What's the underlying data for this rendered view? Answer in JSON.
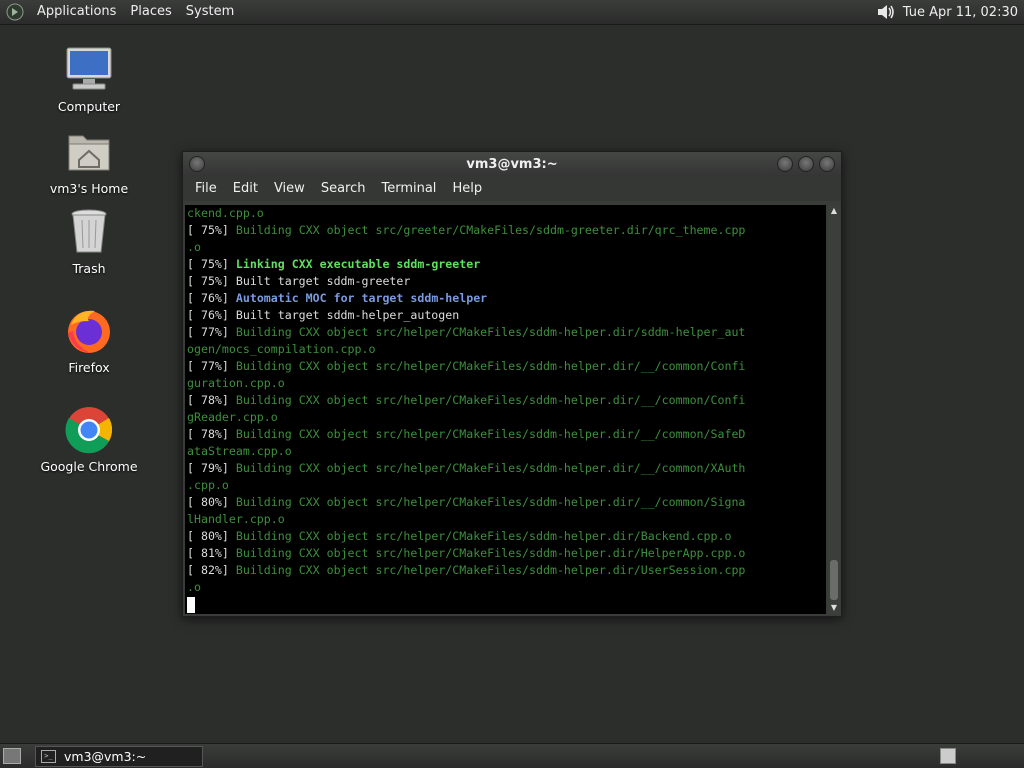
{
  "top_panel": {
    "menus": [
      "Applications",
      "Places",
      "System"
    ],
    "clock": "Tue Apr 11, 02:30",
    "logo_icon": "gnome-foot-icon",
    "volume_icon": "speaker-icon"
  },
  "desktop": {
    "icons": [
      {
        "label": "Computer",
        "icon": "computer-icon"
      },
      {
        "label": "vm3's Home",
        "icon": "home-folder-icon"
      },
      {
        "label": "Trash",
        "icon": "trash-icon"
      },
      {
        "label": "Firefox",
        "icon": "firefox-icon"
      },
      {
        "label": "Google Chrome",
        "icon": "chrome-icon"
      }
    ]
  },
  "terminal": {
    "title": "vm3@vm3:~",
    "menu": [
      "File",
      "Edit",
      "View",
      "Search",
      "Terminal",
      "Help"
    ],
    "lines": [
      {
        "parts": [
          {
            "t": "ckend.cpp.o",
            "c": "dim"
          }
        ]
      },
      {
        "parts": [
          {
            "t": "[ 75%] ",
            "c": "plain"
          },
          {
            "t": "Building CXX object src/greeter/CMakeFiles/sddm-greeter.dir/qrc_theme.cpp",
            "c": "dim"
          }
        ]
      },
      {
        "parts": [
          {
            "t": ".o",
            "c": "dim"
          }
        ]
      },
      {
        "parts": [
          {
            "t": "[ 75%] ",
            "c": "plain"
          },
          {
            "t": "Linking CXX executable sddm-greeter",
            "c": "bright"
          }
        ]
      },
      {
        "parts": [
          {
            "t": "[ 75%] Built target sddm-greeter",
            "c": "plain"
          }
        ]
      },
      {
        "parts": [
          {
            "t": "[ 76%] ",
            "c": "plain"
          },
          {
            "t": "Automatic MOC for target sddm-helper",
            "c": "blue"
          }
        ]
      },
      {
        "parts": [
          {
            "t": "[ 76%] Built target sddm-helper_autogen",
            "c": "plain"
          }
        ]
      },
      {
        "parts": [
          {
            "t": "[ 77%] ",
            "c": "plain"
          },
          {
            "t": "Building CXX object src/helper/CMakeFiles/sddm-helper.dir/sddm-helper_aut",
            "c": "dim"
          }
        ]
      },
      {
        "parts": [
          {
            "t": "ogen/mocs_compilation.cpp.o",
            "c": "dim"
          }
        ]
      },
      {
        "parts": [
          {
            "t": "[ 77%] ",
            "c": "plain"
          },
          {
            "t": "Building CXX object src/helper/CMakeFiles/sddm-helper.dir/__/common/Confi",
            "c": "dim"
          }
        ]
      },
      {
        "parts": [
          {
            "t": "guration.cpp.o",
            "c": "dim"
          }
        ]
      },
      {
        "parts": [
          {
            "t": "[ 78%] ",
            "c": "plain"
          },
          {
            "t": "Building CXX object src/helper/CMakeFiles/sddm-helper.dir/__/common/Confi",
            "c": "dim"
          }
        ]
      },
      {
        "parts": [
          {
            "t": "gReader.cpp.o",
            "c": "dim"
          }
        ]
      },
      {
        "parts": [
          {
            "t": "[ 78%] ",
            "c": "plain"
          },
          {
            "t": "Building CXX object src/helper/CMakeFiles/sddm-helper.dir/__/common/SafeD",
            "c": "dim"
          }
        ]
      },
      {
        "parts": [
          {
            "t": "ataStream.cpp.o",
            "c": "dim"
          }
        ]
      },
      {
        "parts": [
          {
            "t": "[ 79%] ",
            "c": "plain"
          },
          {
            "t": "Building CXX object src/helper/CMakeFiles/sddm-helper.dir/__/common/XAuth",
            "c": "dim"
          }
        ]
      },
      {
        "parts": [
          {
            "t": ".cpp.o",
            "c": "dim"
          }
        ]
      },
      {
        "parts": [
          {
            "t": "[ 80%] ",
            "c": "plain"
          },
          {
            "t": "Building CXX object src/helper/CMakeFiles/sddm-helper.dir/__/common/Signa",
            "c": "dim"
          }
        ]
      },
      {
        "parts": [
          {
            "t": "lHandler.cpp.o",
            "c": "dim"
          }
        ]
      },
      {
        "parts": [
          {
            "t": "[ 80%] ",
            "c": "plain"
          },
          {
            "t": "Building CXX object src/helper/CMakeFiles/sddm-helper.dir/Backend.cpp.o",
            "c": "dim"
          }
        ]
      },
      {
        "parts": [
          {
            "t": "[ 81%] ",
            "c": "plain"
          },
          {
            "t": "Building CXX object src/helper/CMakeFiles/sddm-helper.dir/HelperApp.cpp.o",
            "c": "dim"
          }
        ]
      },
      {
        "parts": [
          {
            "t": "[ 82%] ",
            "c": "plain"
          },
          {
            "t": "Building CXX object src/helper/CMakeFiles/sddm-helper.dir/UserSession.cpp",
            "c": "dim"
          }
        ]
      },
      {
        "parts": [
          {
            "t": ".o",
            "c": "dim"
          }
        ]
      }
    ]
  },
  "taskbar": {
    "task_label": "vm3@vm3:~",
    "show_desktop_icon": "show-desktop-icon",
    "workspace_icon": "workspace-switcher-icon"
  }
}
